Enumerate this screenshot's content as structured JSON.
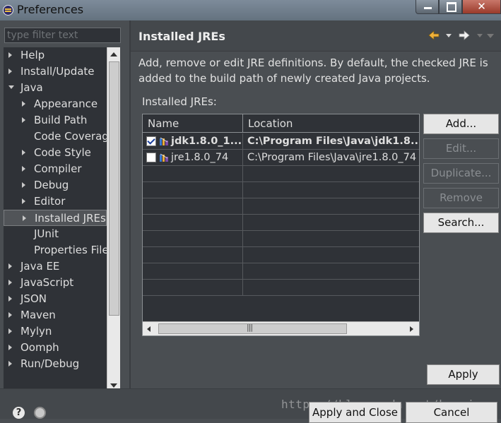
{
  "window": {
    "title": "Preferences"
  },
  "filter": {
    "placeholder": "type filter text"
  },
  "tree": {
    "items": [
      {
        "label": "Help",
        "arrow": "right"
      },
      {
        "label": "Install/Update",
        "arrow": "right"
      },
      {
        "label": "Java",
        "arrow": "down"
      },
      {
        "label": "Appearance",
        "arrow": "right"
      },
      {
        "label": "Build Path",
        "arrow": "right"
      },
      {
        "label": "Code Coverag",
        "arrow": "none"
      },
      {
        "label": "Code Style",
        "arrow": "right"
      },
      {
        "label": "Compiler",
        "arrow": "right"
      },
      {
        "label": "Debug",
        "arrow": "right"
      },
      {
        "label": "Editor",
        "arrow": "right"
      },
      {
        "label": "Installed JREs",
        "arrow": "right",
        "selected": true
      },
      {
        "label": "JUnit",
        "arrow": "none"
      },
      {
        "label": "Properties File",
        "arrow": "none"
      },
      {
        "label": "Java EE",
        "arrow": "right"
      },
      {
        "label": "JavaScript",
        "arrow": "right"
      },
      {
        "label": "JSON",
        "arrow": "right"
      },
      {
        "label": "Maven",
        "arrow": "right"
      },
      {
        "label": "Mylyn",
        "arrow": "right"
      },
      {
        "label": "Oomph",
        "arrow": "right"
      },
      {
        "label": "Run/Debug",
        "arrow": "right"
      }
    ]
  },
  "page": {
    "title": "Installed JREs",
    "description": "Add, remove or edit JRE definitions. By default, the checked JRE is added to the build path of newly created Java projects.",
    "jres_label": "Installed JREs:"
  },
  "table": {
    "columns": [
      "Name",
      "Location"
    ],
    "rows": [
      {
        "name": "jdk1.8.0_1...",
        "location": "C:\\Program Files\\Java\\jdk1.8....",
        "checked": true
      },
      {
        "name": "jre1.8.0_74",
        "location": "C:\\Program Files\\Java\\jre1.8.0_74",
        "checked": false
      }
    ]
  },
  "buttons": {
    "add": "Add...",
    "edit": "Edit...",
    "duplicate": "Duplicate...",
    "remove": "Remove",
    "search": "Search...",
    "apply": "Apply",
    "apply_close": "Apply and Close",
    "cancel": "Cancel"
  },
  "watermark": "https://blog.csdn.net/k_prince",
  "colors": {
    "background": "#4a4e52",
    "panel": "#2f3237",
    "button": "#e6e6e6"
  }
}
